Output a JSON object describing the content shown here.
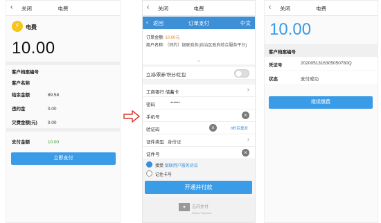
{
  "common": {
    "back_icon": "‹",
    "close_label": "关闭",
    "title": "电费"
  },
  "phone1": {
    "service_name": "电费",
    "amount": "10.00",
    "rows_top": [
      {
        "label": "客户档案编号",
        "value": ""
      },
      {
        "label": "客户名称",
        "value": ""
      }
    ],
    "rows_mid": [
      {
        "label": "结余金额",
        "value": "89.58"
      },
      {
        "label": "违约金",
        "value": "0.00"
      },
      {
        "label": "欠费金额(元)",
        "value": "0.00"
      }
    ],
    "pay_amount_label": "支付金额",
    "pay_amount_value": "10.00",
    "pay_button": "立即支付"
  },
  "phone2": {
    "back_label": "返回",
    "title": "订单支付",
    "lang": "中文",
    "order_amount_label": "订单金额:",
    "order_amount_value": "10.00元",
    "merchant_label": "商户名称:",
    "merchant_value": "（特约）银联商务(自治区政府综合服务平台)",
    "discount_label": "立减/票券/积分/红包",
    "bank_label": "工商银行 储蓄卡",
    "password_label": "密码",
    "password_value": "••••••",
    "phone_label": "手机号",
    "code_label": "验证码",
    "code_resend": "8秒后重发",
    "id_type_label": "证件类型",
    "id_type_value": "身份证",
    "id_no_label": "证件号",
    "agree_label": "接受",
    "agree_link": "银联用户服务协议",
    "remember_label": "记住卡号",
    "submit_button": "开通并付款",
    "footer_logo": "云闪支付",
    "footer_sub": "Online Payment"
  },
  "phone3": {
    "amount": "10.00",
    "customer_label": "客户档案编号",
    "voucher_label": "凭证号",
    "voucher_value": "2020051316305050780Q",
    "status_label": "状态",
    "status_value": "支付成功",
    "continue_button": "继续缴费"
  },
  "colors": {
    "primary_blue": "#3a9be6",
    "header_blue": "#3d8fd6",
    "amount_blue": "#3a9be6",
    "accent_orange": "#e67e22",
    "green": "#3a9b3a",
    "bolt_yellow": "#f5c518"
  }
}
